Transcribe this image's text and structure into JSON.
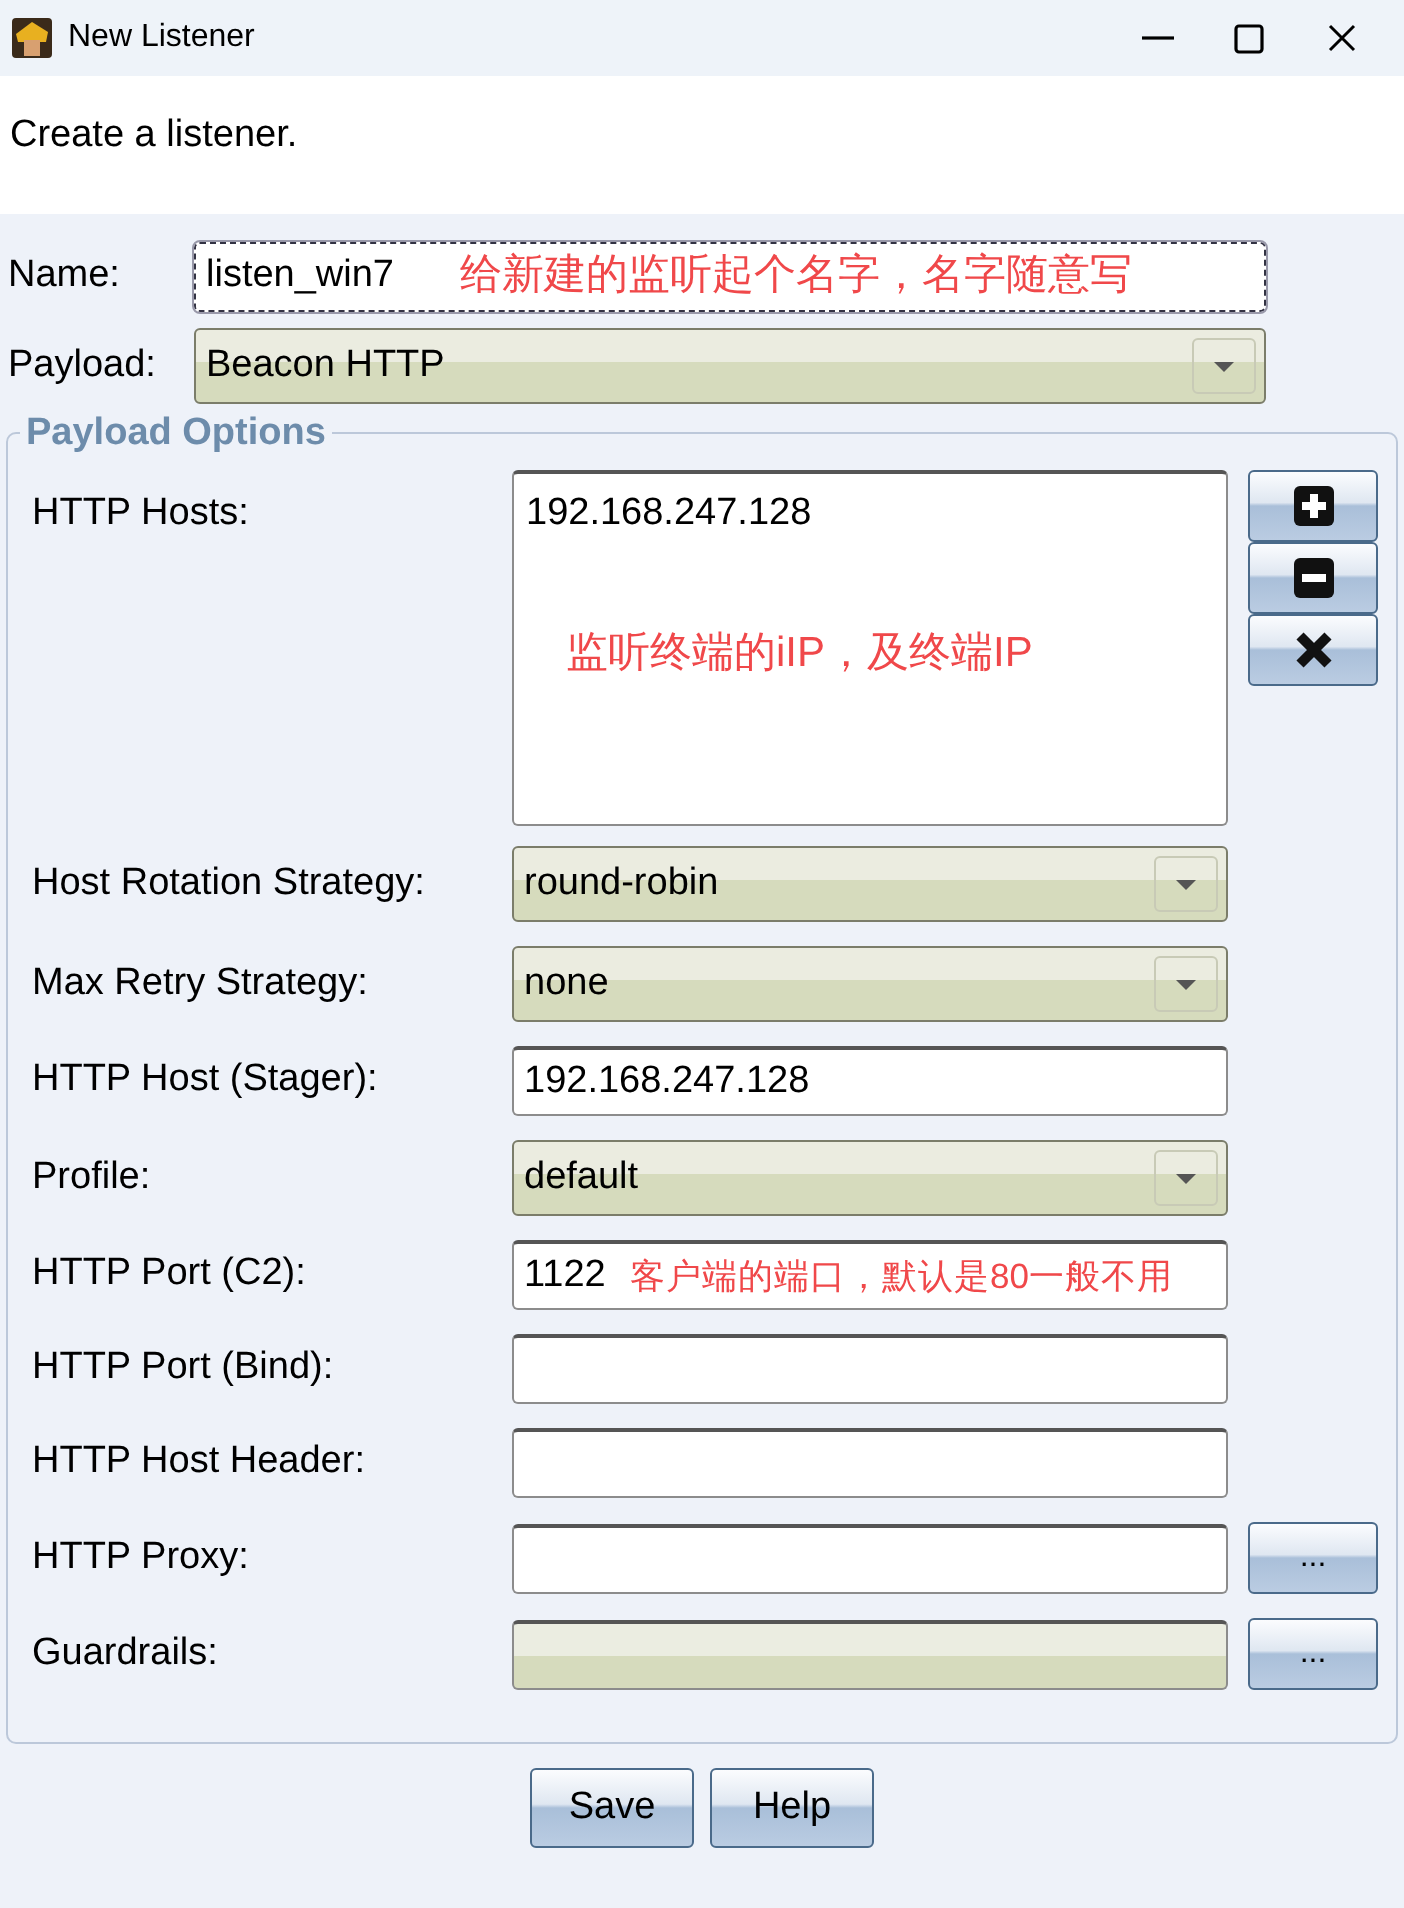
{
  "window": {
    "title": "New Listener"
  },
  "header": "Create a listener.",
  "fields": [
    {
      "label": "Name:",
      "kind": "text",
      "value": "listen_win7",
      "focused": true,
      "note": "给新建的监听起个名字，名字随意写"
    },
    {
      "label": "Payload:",
      "kind": "select",
      "value": "Beacon HTTP"
    }
  ],
  "group": {
    "title": "Payload Options",
    "rows": [
      {
        "label": "HTTP Hosts:",
        "kind": "list",
        "value": "192.168.247.128",
        "note": "监听终端的iIP，及终端IP"
      },
      {
        "label": "Host Rotation Strategy:",
        "kind": "select",
        "value": "round-robin"
      },
      {
        "label": "Max Retry Strategy:",
        "kind": "select",
        "value": "none"
      },
      {
        "label": "HTTP Host (Stager):",
        "kind": "text",
        "value": "192.168.247.128"
      },
      {
        "label": "Profile:",
        "kind": "select",
        "value": "default"
      },
      {
        "label": "HTTP Port (C2):",
        "kind": "text",
        "value": "1122",
        "note": "客户端的端口，默认是80一般不用"
      },
      {
        "label": "HTTP Port (Bind):",
        "kind": "text"
      },
      {
        "label": "HTTP Host Header:",
        "kind": "text"
      },
      {
        "label": "HTTP Proxy:",
        "kind": "browse",
        "browse": "..."
      },
      {
        "label": "Guardrails:",
        "kind": "browse-locked",
        "browse": "..."
      }
    ]
  },
  "buttons": [
    "Save",
    "Help"
  ]
}
